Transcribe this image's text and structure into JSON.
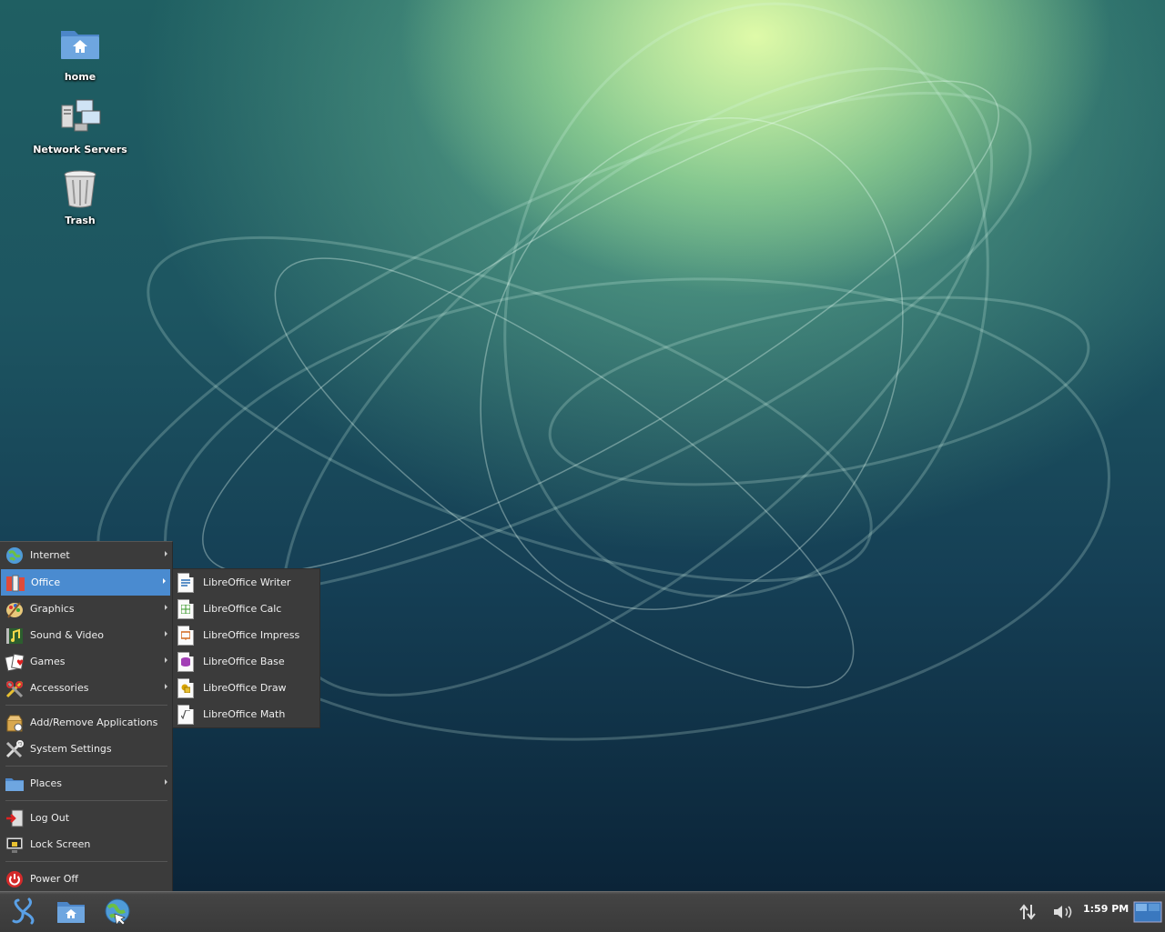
{
  "desktop": {
    "icons": [
      {
        "label": "home",
        "icon": "home-folder-icon"
      },
      {
        "label": "Network Servers",
        "icon": "network-servers-icon"
      },
      {
        "label": "Trash",
        "icon": "trash-icon"
      }
    ]
  },
  "start_menu": {
    "items": [
      {
        "label": "Internet",
        "icon": "globe-icon",
        "submenu": true
      },
      {
        "label": "Office",
        "icon": "office-icon",
        "submenu": true,
        "active": true
      },
      {
        "label": "Graphics",
        "icon": "graphics-icon",
        "submenu": true
      },
      {
        "label": "Sound & Video",
        "icon": "sound-video-icon",
        "submenu": true
      },
      {
        "label": "Games",
        "icon": "games-icon",
        "submenu": true
      },
      {
        "label": "Accessories",
        "icon": "accessories-icon",
        "submenu": true
      },
      {
        "label": "Add/Remove Applications",
        "icon": "add-remove-icon",
        "submenu": false
      },
      {
        "label": "System Settings",
        "icon": "settings-icon",
        "submenu": false
      },
      {
        "label": "Places",
        "icon": "folder-icon",
        "submenu": true
      },
      {
        "label": "Log Out",
        "icon": "logout-icon",
        "submenu": false
      },
      {
        "label": "Lock Screen",
        "icon": "lock-screen-icon",
        "submenu": false
      },
      {
        "label": "Power Off",
        "icon": "power-icon",
        "submenu": false
      }
    ],
    "office_submenu": [
      {
        "label": "LibreOffice Writer",
        "icon": "writer-icon",
        "color": "#2a6fb8"
      },
      {
        "label": "LibreOffice Calc",
        "icon": "calc-icon",
        "color": "#3a9a2a"
      },
      {
        "label": "LibreOffice Impress",
        "icon": "impress-icon",
        "color": "#d2691e"
      },
      {
        "label": "LibreOffice Base",
        "icon": "base-icon",
        "color": "#a23fb5"
      },
      {
        "label": "LibreOffice Draw",
        "icon": "draw-icon",
        "color": "#d9a400"
      },
      {
        "label": "LibreOffice Math",
        "icon": "math-icon",
        "color": "#666666"
      }
    ]
  },
  "taskbar": {
    "clock": "1:59 PM",
    "accent": "#4a8bd0"
  }
}
